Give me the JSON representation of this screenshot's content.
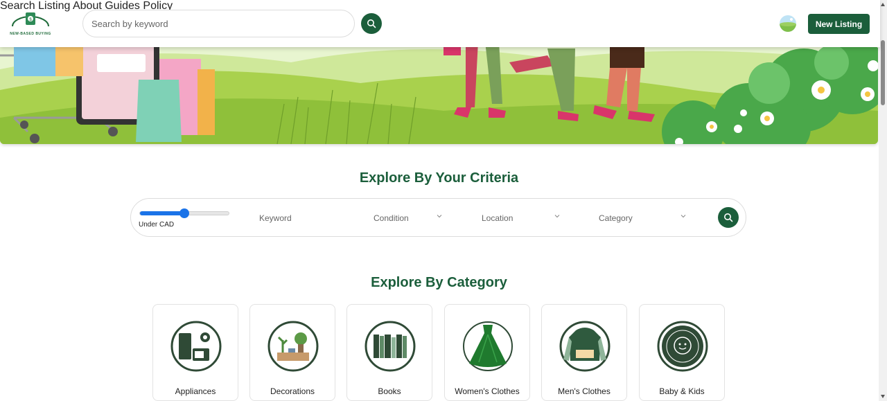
{
  "header": {
    "logo_text": "NEW-BASED BUYING",
    "search_placeholder": "Search by keyword",
    "nav": [
      {
        "label": "Search"
      },
      {
        "label": "Listing"
      },
      {
        "label": "About"
      },
      {
        "label": "Guides"
      },
      {
        "label": "Policy"
      }
    ],
    "new_listing_label": "New Listing"
  },
  "criteria": {
    "title": "Explore By Your Criteria",
    "price_label": "Under CAD",
    "price_slider_fraction": 0.5,
    "keyword_placeholder": "Keyword",
    "condition_label": "Condition",
    "location_label": "Location",
    "category_label": "Category"
  },
  "categories": {
    "title": "Explore By Category",
    "items": [
      {
        "label": "Appliances",
        "icon": "appliances-icon"
      },
      {
        "label": "Decorations",
        "icon": "decorations-icon"
      },
      {
        "label": "Books",
        "icon": "books-icon"
      },
      {
        "label": "Women's Clothes",
        "icon": "dress-icon"
      },
      {
        "label": "Men's Clothes",
        "icon": "hoodie-icon"
      },
      {
        "label": "Baby & Kids",
        "icon": "baby-badge-icon"
      }
    ]
  },
  "colors": {
    "brand": "#1b5e3b",
    "heading": "#1b5e3b",
    "slider": "#1a73e8"
  }
}
